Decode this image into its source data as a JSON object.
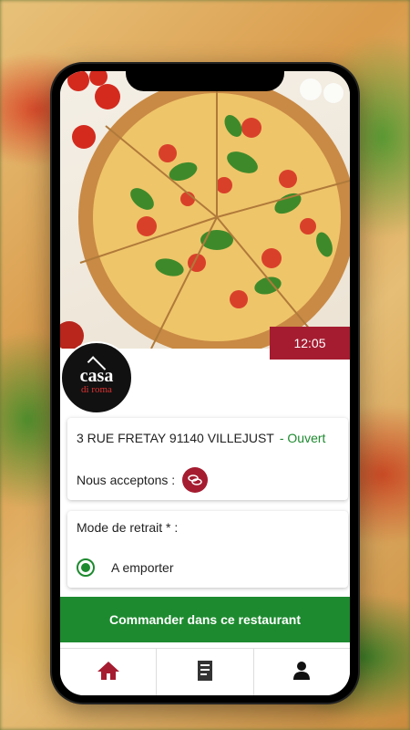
{
  "restaurant": {
    "logo_line1": "casa",
    "logo_line2": "di roma",
    "pickup_time": "12:05",
    "address": "3 RUE FRETAY 91140 VILLEJUST",
    "status": "- Ouvert",
    "accept_label": "Nous acceptons :"
  },
  "pickup": {
    "mode_label": "Mode de retrait * :",
    "option_label": "A emporter",
    "selected": true
  },
  "actions": {
    "order_label": "Commander dans ce restaurant"
  },
  "tabbar": {
    "items": [
      {
        "icon": "home-icon"
      },
      {
        "icon": "receipt-icon"
      },
      {
        "icon": "user-icon"
      }
    ]
  },
  "colors": {
    "brand_red": "#a51c30",
    "brand_green": "#1d8a2f"
  }
}
